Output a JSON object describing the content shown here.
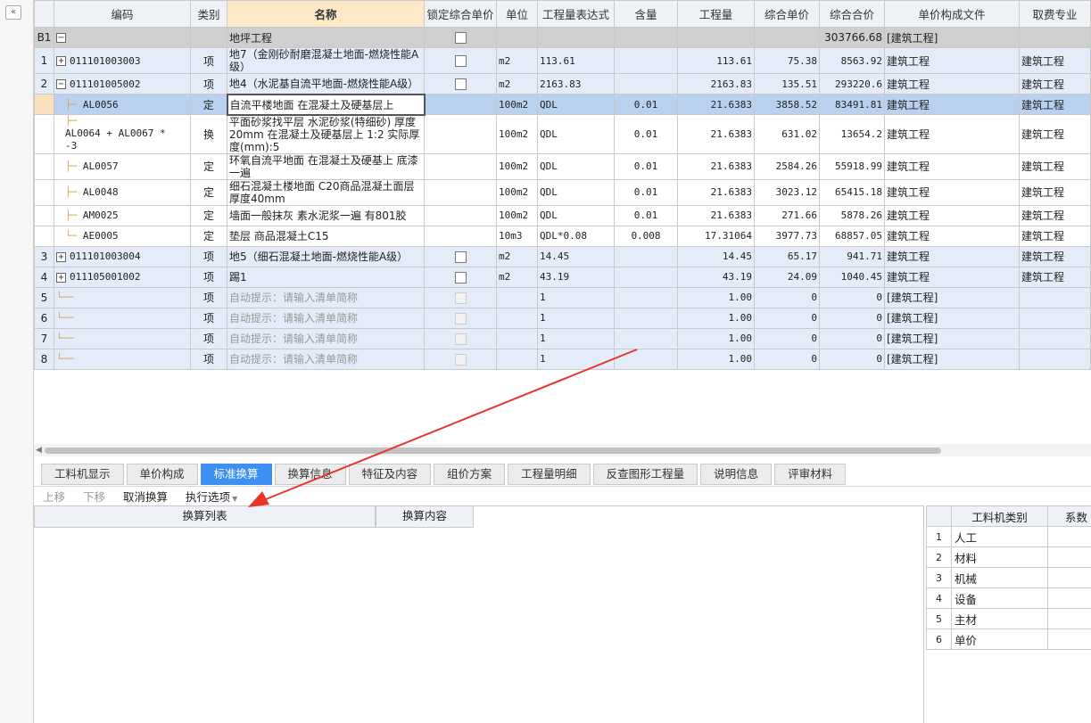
{
  "collapse_label": "«",
  "columns": [
    "编码",
    "类别",
    "名称",
    "锁定综合单价",
    "单位",
    "工程量表达式",
    "含量",
    "工程量",
    "综合单价",
    "综合合价",
    "单价构成文件",
    "取费专业"
  ],
  "b1": {
    "rn": "B1",
    "name": "地坪工程",
    "total": "303766.68",
    "file": "[建筑工程]"
  },
  "rows": [
    {
      "rn": "1",
      "code": "011101003003",
      "type": "项",
      "name": "地7（金刚砂耐磨混凝土地面-燃烧性能A级）",
      "unit": "m2",
      "expr": "113.61",
      "content": "",
      "qty": "113.61",
      "price": "75.38",
      "total": "8563.92",
      "file": "建筑工程",
      "prof": "建筑工程"
    },
    {
      "rn": "2",
      "code": "011101005002",
      "type": "项",
      "name": "地4（水泥基自流平地面-燃烧性能A级）",
      "unit": "m2",
      "expr": "2163.83",
      "content": "",
      "qty": "2163.83",
      "price": "135.51",
      "total": "293220.6",
      "file": "建筑工程",
      "prof": "建筑工程"
    },
    {
      "rn": "",
      "code": "AL0056",
      "type": "定",
      "name": "自流平楼地面 在混凝土及硬基层上",
      "unit": "100m2",
      "expr": "QDL",
      "content": "0.01",
      "qty": "21.6383",
      "price": "3858.52",
      "total": "83491.81",
      "file": "建筑工程",
      "prof": "建筑工程"
    },
    {
      "rn": "",
      "code": "AL0064 + AL0067 * -3",
      "type": "换",
      "name": "平面砂浆找平层 水泥砂浆(特细砂) 厚度20mm 在混凝土及硬基层上 1:2  实际厚度(mm):5",
      "unit": "100m2",
      "expr": "QDL",
      "content": "0.01",
      "qty": "21.6383",
      "price": "631.02",
      "total": "13654.2",
      "file": "建筑工程",
      "prof": "建筑工程"
    },
    {
      "rn": "",
      "code": "AL0057",
      "type": "定",
      "name": "环氧自流平地面 在混凝土及硬基上 底漆一遍",
      "unit": "100m2",
      "expr": "QDL",
      "content": "0.01",
      "qty": "21.6383",
      "price": "2584.26",
      "total": "55918.99",
      "file": "建筑工程",
      "prof": "建筑工程"
    },
    {
      "rn": "",
      "code": "AL0048",
      "type": "定",
      "name": "细石混凝土楼地面 C20商品混凝土面层 厚度40mm",
      "unit": "100m2",
      "expr": "QDL",
      "content": "0.01",
      "qty": "21.6383",
      "price": "3023.12",
      "total": "65415.18",
      "file": "建筑工程",
      "prof": "建筑工程"
    },
    {
      "rn": "",
      "code": "AM0025",
      "type": "定",
      "name": "墙面一般抹灰 素水泥浆一遍 有801胶",
      "unit": "100m2",
      "expr": "QDL",
      "content": "0.01",
      "qty": "21.6383",
      "price": "271.66",
      "total": "5878.26",
      "file": "建筑工程",
      "prof": "建筑工程"
    },
    {
      "rn": "",
      "code": "AE0005",
      "type": "定",
      "name": "垫层 商品混凝土C15",
      "unit": "10m3",
      "expr": "QDL*0.08",
      "content": "0.008",
      "qty": "17.31064",
      "price": "3977.73",
      "total": "68857.05",
      "file": "建筑工程",
      "prof": "建筑工程"
    },
    {
      "rn": "3",
      "code": "011101003004",
      "type": "项",
      "name": "地5（细石混凝土地面-燃烧性能A级）",
      "unit": "m2",
      "expr": "14.45",
      "content": "",
      "qty": "14.45",
      "price": "65.17",
      "total": "941.71",
      "file": "建筑工程",
      "prof": "建筑工程"
    },
    {
      "rn": "4",
      "code": "011105001002",
      "type": "项",
      "name": "踢1",
      "unit": "m2",
      "expr": "43.19",
      "content": "",
      "qty": "43.19",
      "price": "24.09",
      "total": "1040.45",
      "file": "建筑工程",
      "prof": "建筑工程"
    },
    {
      "rn": "5",
      "code": "",
      "type": "项",
      "name": "自动提示：请输入清单简称",
      "unit": "",
      "expr": "1",
      "content": "",
      "qty": "1.00",
      "price": "0",
      "total": "0",
      "file": "[建筑工程]",
      "prof": ""
    },
    {
      "rn": "6",
      "code": "",
      "type": "项",
      "name": "自动提示：请输入清单简称",
      "unit": "",
      "expr": "1",
      "content": "",
      "qty": "1.00",
      "price": "0",
      "total": "0",
      "file": "[建筑工程]",
      "prof": ""
    },
    {
      "rn": "7",
      "code": "",
      "type": "项",
      "name": "自动提示：请输入清单简称",
      "unit": "",
      "expr": "1",
      "content": "",
      "qty": "1.00",
      "price": "0",
      "total": "0",
      "file": "[建筑工程]",
      "prof": ""
    },
    {
      "rn": "8",
      "code": "",
      "type": "项",
      "name": "自动提示：请输入清单简称",
      "unit": "",
      "expr": "1",
      "content": "",
      "qty": "1.00",
      "price": "0",
      "total": "0",
      "file": "[建筑工程]",
      "prof": ""
    }
  ],
  "tabs": [
    "工料机显示",
    "单价构成",
    "标准换算",
    "换算信息",
    "特征及内容",
    "组价方案",
    "工程量明细",
    "反查图形工程量",
    "说明信息",
    "评审材料"
  ],
  "active_tab": "标准换算",
  "toolbar": {
    "up": "上移",
    "down": "下移",
    "cancel": "取消换算",
    "exec": "执行选项"
  },
  "conv": {
    "col1": "换算列表",
    "col2": "换算内容"
  },
  "right": {
    "col1": "工料机类别",
    "col2": "系数",
    "items": [
      "人工",
      "材料",
      "机械",
      "设备",
      "主材",
      "单价"
    ]
  },
  "colors": {
    "active_tab": "#3d8ff2",
    "arrow": "#e8352a",
    "row_qd": "#e3ecf8",
    "row_sel": "#b9d1ef"
  }
}
